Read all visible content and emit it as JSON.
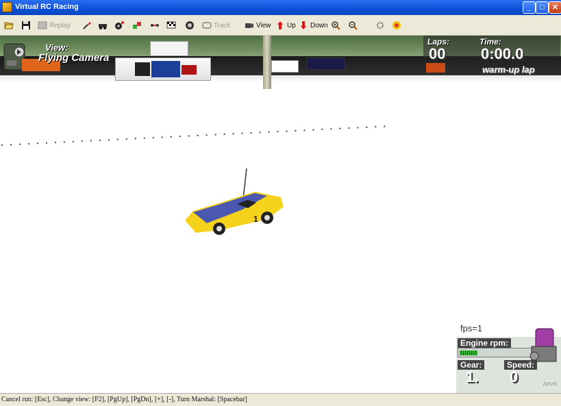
{
  "window": {
    "title": "Virtual RC Racing",
    "minimize": "_",
    "maximize": "□",
    "close": "✕"
  },
  "toolbar": {
    "replay_label": "Replay",
    "track_label": "Track",
    "view_label": "View",
    "up_label": "Up",
    "down_label": "Down"
  },
  "hud": {
    "view_label": "View:",
    "view_value": "Flying Camera",
    "laps_label": "Laps:",
    "laps_value": "00",
    "time_label": "Time:",
    "time_value": "0:00.0",
    "warmup_text": "warm-up lap",
    "fps_text": "fps=1",
    "rpm_label": "Engine rpm:",
    "rpm_level": 0.25,
    "gear_label": "Gear:",
    "gear_value": "1.",
    "speed_label": "Speed:",
    "speed_value": "0",
    "speed_unit": "km/h"
  },
  "car": {
    "number": "1",
    "body_color": "#f5d21c",
    "accent_color": "#2b43c9"
  },
  "statusbar": {
    "text": "Cancel run: [Esc], Change view: [F2], [PgUp], [PgDn], [+], [-], Turn Marshal: [Spacebar]"
  },
  "colors": {
    "titlebar": "#0a4fd6",
    "chrome": "#ece9d8",
    "close_button": "#c33d16"
  }
}
